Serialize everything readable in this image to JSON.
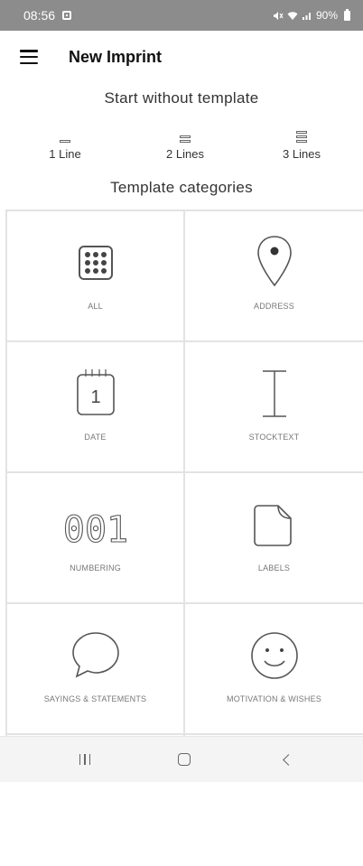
{
  "status_bar": {
    "time": "08:56",
    "battery": "90%"
  },
  "app_bar": {
    "title": "New Imprint"
  },
  "start_section": {
    "title": "Start without template",
    "options": [
      {
        "label": "1 Line",
        "lines": 1
      },
      {
        "label": "2 Lines",
        "lines": 2
      },
      {
        "label": "3 Lines",
        "lines": 3
      }
    ]
  },
  "categories_section": {
    "title": "Template categories",
    "items": [
      {
        "label": "ALL",
        "icon": "grid-dots-icon"
      },
      {
        "label": "ADDRESS",
        "icon": "map-pin-icon"
      },
      {
        "label": "DATE",
        "icon": "calendar-icon"
      },
      {
        "label": "STOCKTEXT",
        "icon": "text-cursor-icon"
      },
      {
        "label": "NUMBERING",
        "icon": "numbering-icon"
      },
      {
        "label": "LABELS",
        "icon": "label-page-icon"
      },
      {
        "label": "SAYINGS & STATEMENTS",
        "icon": "speech-bubble-icon"
      },
      {
        "label": "MOTIVATION & WISHES",
        "icon": "smiley-icon"
      }
    ]
  },
  "icon_text": {
    "date_number": "1",
    "numbering": "001"
  },
  "colors": {
    "status_bar_bg": "#8c8c8c",
    "icon_stroke": "#555555",
    "grid_line": "#e3e3e3"
  }
}
